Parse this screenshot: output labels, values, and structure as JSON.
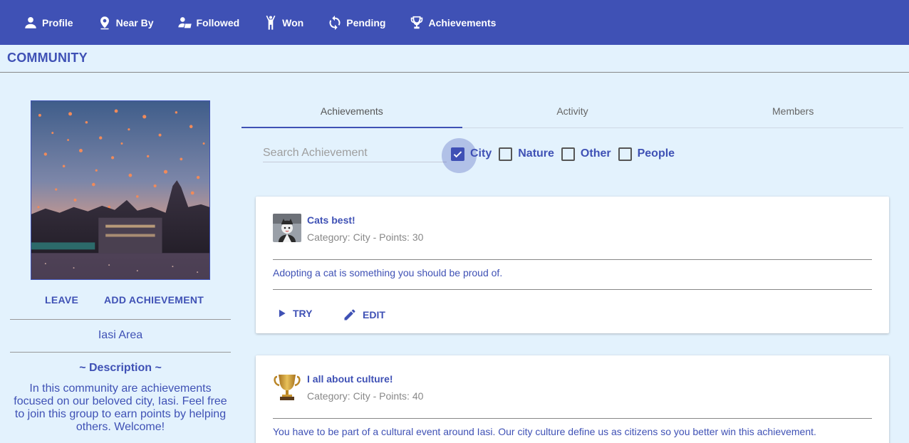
{
  "nav": {
    "items": [
      {
        "label": "Profile",
        "icon": "person-icon"
      },
      {
        "label": "Near By",
        "icon": "location-pin-icon"
      },
      {
        "label": "Followed",
        "icon": "followed-icon"
      },
      {
        "label": "Won",
        "icon": "won-figure-icon"
      },
      {
        "label": "Pending",
        "icon": "sync-icon"
      },
      {
        "label": "Achievements",
        "icon": "trophy-icon"
      }
    ]
  },
  "page": {
    "title": "COMMUNITY"
  },
  "community": {
    "leave_label": "LEAVE",
    "add_achievement_label": "ADD ACHIEVEMENT",
    "area": "Iasi Area",
    "description_title": "~ Description ~",
    "description": "In this community are achievements focused on our beloved city, Iasi. Feel free to join this group to earn points by helping others. Welcome!"
  },
  "tabs": [
    {
      "label": "Achievements",
      "active": true
    },
    {
      "label": "Activity",
      "active": false
    },
    {
      "label": "Members",
      "active": false
    }
  ],
  "search": {
    "placeholder": "Search Achievement",
    "value": ""
  },
  "filters": [
    {
      "label": "City",
      "checked": true
    },
    {
      "label": "Nature",
      "checked": false
    },
    {
      "label": "Other",
      "checked": false
    },
    {
      "label": "People",
      "checked": false
    }
  ],
  "achievements": [
    {
      "title": "Cats best!",
      "subtitle": "Category: City - Points: 30",
      "description": "Adopting a cat is something you should be proud of.",
      "try_label": "TRY",
      "edit_label": "EDIT",
      "thumb_icon": "cat-avatar-icon"
    },
    {
      "title": "I all about culture!",
      "subtitle": "Category: City - Points: 40",
      "description": "You have to be part of a cultural event around Iasi. Our city culture define us as citizens so you better win this achievement.",
      "thumb_icon": "trophy-icon"
    }
  ],
  "colors": {
    "primary": "#3f51b5",
    "background": "#e3f2fd",
    "card": "#ffffff"
  }
}
